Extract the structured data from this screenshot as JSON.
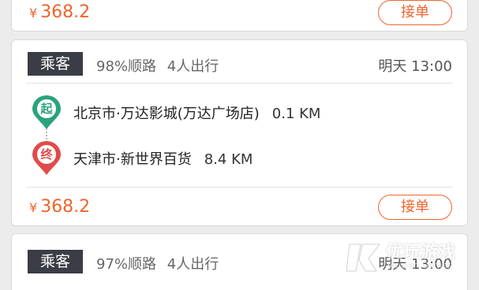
{
  "currency_symbol": "¥",
  "cards": [
    {
      "price": "368.2",
      "accept_label": "接单"
    },
    {
      "role_badge": "乘客",
      "match_info": "98%顺路",
      "passengers": "4人出行",
      "time": "明天 13:00",
      "start_pin": "起",
      "start_place": "北京市·万达影城(万达广场店)",
      "start_distance": "0.1 KM",
      "end_pin": "终",
      "end_place": "天津市·新世界百货",
      "end_distance": "8.4 KM",
      "price": "368.2",
      "accept_label": "接单"
    },
    {
      "role_badge": "乘客",
      "match_info": "97%顺路",
      "passengers": "4人出行",
      "time": "明天 13:00"
    }
  ],
  "watermark": {
    "text": "优玩游戏",
    "sub": "Youwan Games"
  },
  "colors": {
    "accent": "#f0642d",
    "start_pin": "#2aa37a",
    "end_pin": "#e24a4a",
    "badge_bg": "#3a3d45"
  }
}
